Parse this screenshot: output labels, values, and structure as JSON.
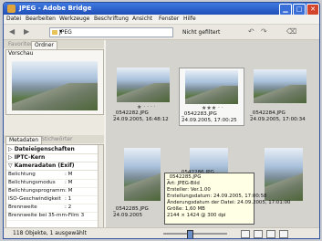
{
  "window": {
    "title": "JPEG - Adobe Bridge",
    "minimize": "▁",
    "maximize": "□",
    "close": "✕"
  },
  "menu": [
    "Datei",
    "Bearbeiten",
    "Werkzeuge",
    "Beschriftung",
    "Ansicht",
    "Fenster",
    "Hilfe"
  ],
  "toolbar": {
    "path": "JPEG",
    "filter": "Nicht gefiltert",
    "back": "◀",
    "forward": "▶",
    "rotate_left": "↶",
    "rotate_right": "↷"
  },
  "left": {
    "tabs": [
      "Favoriten",
      "Ordner"
    ],
    "preview_label": "Vorschau",
    "meta_tabs": [
      "Metadaten",
      "Stichwörter"
    ],
    "sections": [
      "Dateieigenschaften",
      "IPTC-Kern",
      "Kameradaten (Exif)"
    ],
    "rows": [
      {
        "label": "Belichtung",
        "value": ": M"
      },
      {
        "label": "Belichtungsmodus",
        "value": ": M"
      },
      {
        "label": "Belichtungsprogramm",
        "value": ": M"
      },
      {
        "label": "ISO-Geschwindigkeit",
        "value": ": 1"
      },
      {
        "label": "Brennweite",
        "value": ": 2"
      },
      {
        "label": "Brennweite bei 35-mm-Film",
        "value": ": 3"
      }
    ]
  },
  "thumbs": [
    {
      "name": "_0542282.JPG",
      "date": "24.09.2005, 16:48:12",
      "stars": "★ · · · ·"
    },
    {
      "name": "_0542283.JPG",
      "date": "24.09.2005, 17:00:25",
      "stars": "★★★ · ·"
    },
    {
      "name": "_0542284.JPG",
      "date": "24.09.2005, 17:00:34",
      "stars": ""
    },
    {
      "name": "_0542285.JPG",
      "date": "24.09.2005",
      "stars": ""
    },
    {
      "name": "_0542286.JPG",
      "date": "",
      "stars": ""
    },
    {
      "name": "",
      "date": "",
      "stars": ""
    }
  ],
  "tooltip": [
    "_0542285.JPG",
    "Art: JPEG-Bild",
    "Ersteller: Ver.1.00",
    "Erstellungsdatum: 24.09.2005, 17:00:58",
    "Änderungsdatum der Datei: 24.09.2005, 17:01:00",
    "Größe: 1,60 MB",
    "2144 × 1424 @ 300 dpi"
  ],
  "status": {
    "text": "118 Objekte, 1 ausgewählt"
  }
}
